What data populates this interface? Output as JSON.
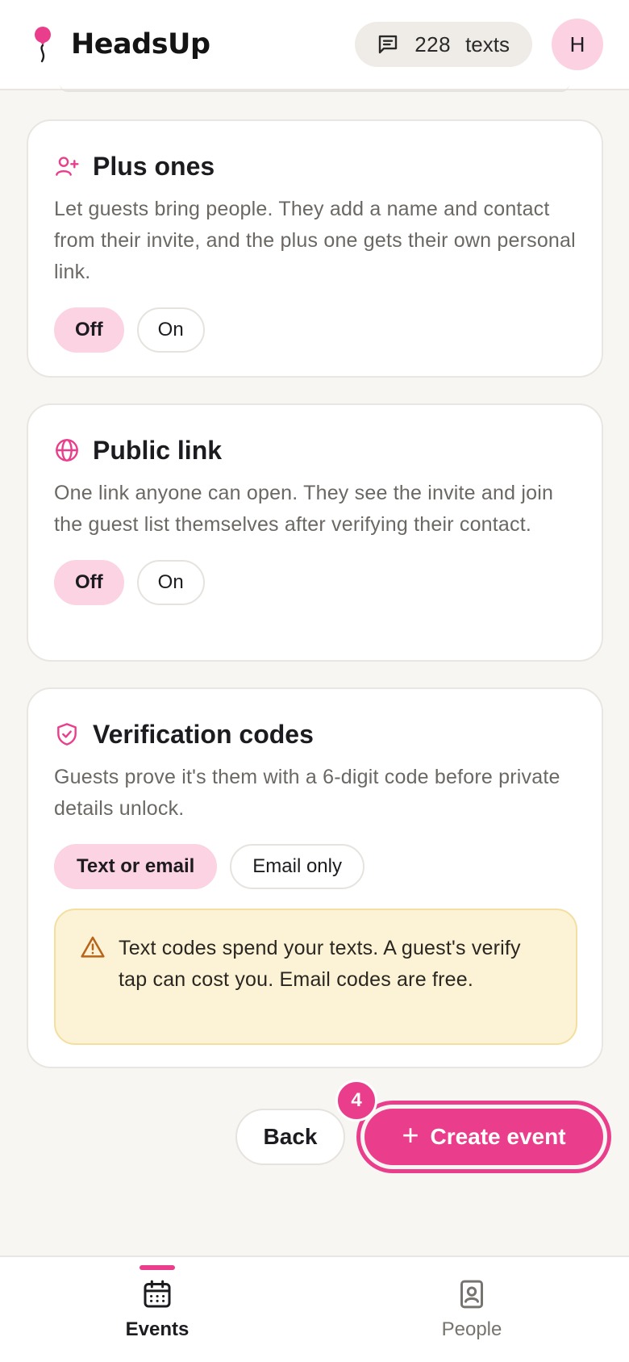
{
  "header": {
    "app_name": "HeadsUp",
    "texts_count": "228",
    "texts_label": "texts",
    "avatar_initial": "H"
  },
  "cards": {
    "plus_ones": {
      "title": "Plus ones",
      "description": "Let guests bring people. They add a name and contact from their invite, and the plus one gets their own personal link.",
      "options": [
        "Off",
        "On"
      ],
      "selected": "Off"
    },
    "public_link": {
      "title": "Public link",
      "description": "One link anyone can open. They see the invite and join the guest list themselves after verifying their contact.",
      "options": [
        "Off",
        "On"
      ],
      "selected": "Off"
    },
    "verification": {
      "title": "Verification codes",
      "description": "Guests prove it's them with a 6-digit code before private details unlock.",
      "options": [
        "Text or email",
        "Email only"
      ],
      "selected": "Text or email",
      "warning": "Text codes spend your texts. A guest's verify tap can cost you. Email codes are free."
    }
  },
  "actions": {
    "back_label": "Back",
    "create_label": "Create event",
    "step_badge": "4"
  },
  "nav": {
    "events_label": "Events",
    "people_label": "People",
    "active": "Events"
  },
  "colors": {
    "accent": "#ea3e8c",
    "selected_pill": "#fcd3e3",
    "warning_bg": "#fcf2d6",
    "warning_icon": "#b8651a"
  }
}
